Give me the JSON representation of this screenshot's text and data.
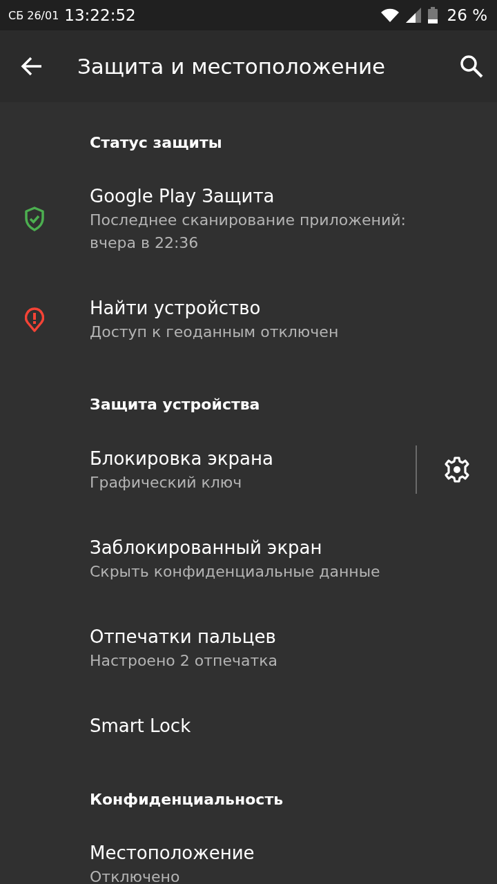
{
  "status_bar": {
    "date": "СБ 26/01",
    "time": "13:22:52",
    "battery": "26 %"
  },
  "app_bar": {
    "title": "Защита и местоположение"
  },
  "list": [
    {
      "kind": "header",
      "title": "Статус защиты"
    },
    {
      "kind": "status_item",
      "alert": false,
      "color": "#4caf50",
      "title": "Google Play Защита",
      "subtitle": "Последнее сканирование приложений: вчера в 22:36"
    },
    {
      "kind": "status_item",
      "alert": true,
      "color": "#f44336",
      "title": "Найти устройство",
      "subtitle": "Доступ к геоданным отключен"
    },
    {
      "kind": "header",
      "title": "Защита устройства"
    },
    {
      "kind": "item",
      "title": "Блокировка экрана",
      "subtitle": "Графический ключ",
      "settings": true
    },
    {
      "kind": "item",
      "title": "Заблокированный экран",
      "subtitle": "Скрыть конфиденциальные данные"
    },
    {
      "kind": "item",
      "title": "Отпечатки пальцев",
      "subtitle": "Настроено 2 отпечатка"
    },
    {
      "kind": "item",
      "title": "Smart Lock"
    },
    {
      "kind": "header",
      "title": "Конфиденциальность"
    },
    {
      "kind": "item",
      "title": "Местоположение",
      "subtitle": "Отключено"
    }
  ]
}
